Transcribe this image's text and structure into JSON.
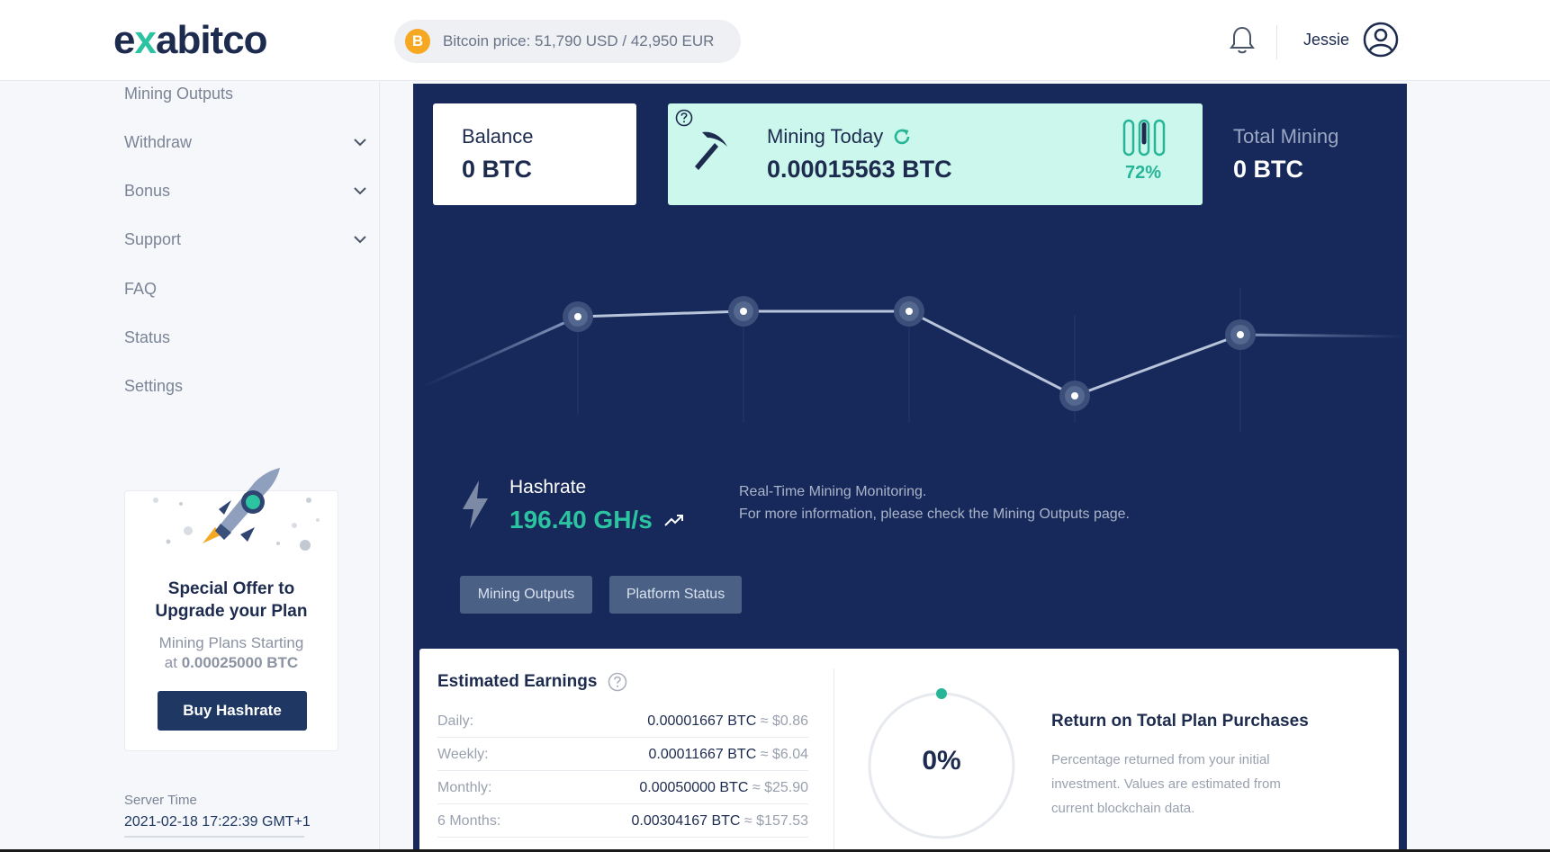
{
  "header": {
    "logo_pre": "e",
    "logo_x": "x",
    "logo_post": "abitco",
    "btc_symbol": "B",
    "price_text": "Bitcoin price: 51,790 USD / 42,950 EUR",
    "username": "Jessie"
  },
  "sidebar": {
    "items": [
      {
        "label": "Mining Outputs"
      },
      {
        "label": "Withdraw"
      },
      {
        "label": "Bonus"
      },
      {
        "label": "Support"
      },
      {
        "label": "FAQ"
      },
      {
        "label": "Status"
      },
      {
        "label": "Settings"
      }
    ],
    "promo": {
      "title_line1": "Special Offer to",
      "title_line2": "Upgrade your Plan",
      "sub_line1": "Mining Plans Starting",
      "sub_pre": "at ",
      "sub_value": "0.00025000 BTC",
      "button": "Buy Hashrate"
    },
    "server_label": "Server Time",
    "server_time": "2021-02-18 17:22:39 GMT+1"
  },
  "stats": {
    "balance_label": "Balance",
    "balance_value": "0 BTC",
    "mining_label": "Mining Today",
    "mining_value": "0.00015563 BTC",
    "gauge_pct": "72%",
    "gauge_level": 0.72,
    "total_label": "Total Mining",
    "total_value": "0 BTC"
  },
  "hashrate": {
    "label": "Hashrate",
    "value": "196.40 GH/s",
    "info_line1": "Real-Time Mining Monitoring.",
    "info_line2": "For more information, please check the Mining Outputs page.",
    "btn_outputs": "Mining Outputs",
    "btn_status": "Platform Status"
  },
  "earnings": {
    "title": "Estimated Earnings",
    "rows": [
      {
        "label": "Daily:",
        "btc": "0.00001667 BTC",
        "sep": "≈",
        "usd": "$0.86"
      },
      {
        "label": "Weekly:",
        "btc": "0.00011667 BTC",
        "sep": "≈",
        "usd": "$6.04"
      },
      {
        "label": "Monthly:",
        "btc": "0.00050000 BTC",
        "sep": "≈",
        "usd": "$25.90"
      },
      {
        "label": "6 Months:",
        "btc": "0.00304167 BTC",
        "sep": "≈",
        "usd": "$157.53"
      }
    ],
    "return_pct": "0%",
    "return_value": 0,
    "return_title": "Return on Total Plan Purchases",
    "return_desc": "Percentage returned from your initial investment. Values are estimated from current blockchain data."
  },
  "icons": {
    "bell": "bell-icon",
    "user": "user-icon",
    "chevron": "chevron-down-icon",
    "rocket": "rocket-icon",
    "question": "question-icon",
    "pickaxe": "pickaxe-icon",
    "refresh": "refresh-icon",
    "gauge": "gauge-icon",
    "bolt": "bolt-icon",
    "trend": "trend-up-icon"
  },
  "colors": {
    "dark_panel": "#16295a",
    "accent_green": "#2cc3a0",
    "mint_card": "#ccf7ec",
    "btc_orange": "#f7a823",
    "button_navy": "#1f3863"
  }
}
